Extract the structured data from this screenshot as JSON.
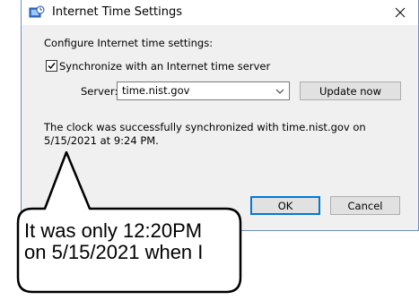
{
  "window": {
    "title": "Internet Time Settings",
    "icon": "clock-globe-icon",
    "close_icon": "close-icon"
  },
  "content": {
    "configure_label": "Configure Internet time settings:",
    "sync_checkbox_label": "Synchronize with an Internet time server",
    "sync_checked": true,
    "server_label": "Server:",
    "server_value": "time.nist.gov",
    "update_button": "Update now",
    "status_text": "The clock was successfully synchronized with time.nist.gov on 5/15/2021 at 9:24 PM."
  },
  "buttons": {
    "ok": "OK",
    "cancel": "Cancel"
  },
  "callout": {
    "line1": "It was only 12:20PM",
    "line2": "on 5/15/2021 when I"
  },
  "colors": {
    "dialog_bg": "#f0f0f0",
    "accent_focus": "#0078d7",
    "button_bg": "#e1e1e1"
  }
}
